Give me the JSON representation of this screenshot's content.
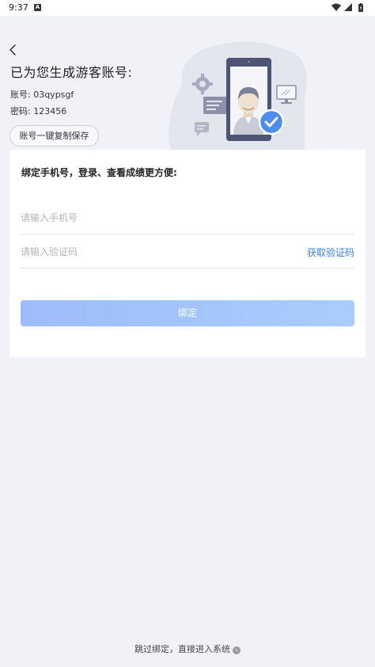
{
  "status_bar": {
    "time": "9:37",
    "notification_icon": "A"
  },
  "header": {
    "title": "已为您生成游客账号:",
    "account_label": "账号: ",
    "account_value": "03qypsgf",
    "password_label": "密码: ",
    "password_value": "123456",
    "copy_button_label": "账号一键复制保存"
  },
  "bind_card": {
    "title": "绑定手机号，登录、查看成绩更方便:",
    "phone_placeholder": "请输入手机号",
    "code_placeholder": "请输入验证码",
    "get_code_label": "获取验证码",
    "bind_button_label": "绑定"
  },
  "footer": {
    "skip_label": "跳过绑定，直接进入系统"
  },
  "colors": {
    "accent": "#3b82e6",
    "button_gradient_start": "#9ebcfa",
    "button_gradient_end": "#a9cdfb",
    "background": "#f1f2f7"
  },
  "icons": {
    "back": "chevron-left-icon",
    "wifi": "wifi-icon",
    "signal": "signal-icon",
    "battery": "battery-icon",
    "skip": "chevron-right-circle-icon"
  }
}
